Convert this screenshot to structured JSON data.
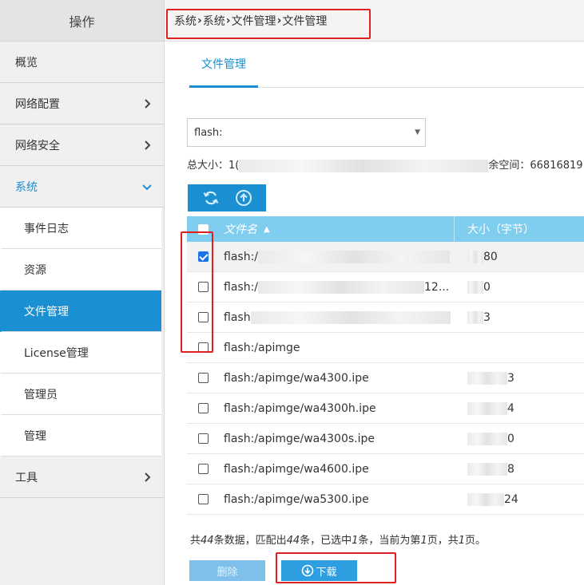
{
  "sidebar": {
    "header": "操作",
    "items": [
      {
        "label": "概览",
        "chevron": "none"
      },
      {
        "label": "网络配置",
        "chevron": "right"
      },
      {
        "label": "网络安全",
        "chevron": "right"
      }
    ],
    "system": {
      "label": "系统",
      "chevron": "down",
      "children": [
        {
          "label": "事件日志"
        },
        {
          "label": "资源"
        },
        {
          "label": "文件管理"
        },
        {
          "label": "License管理"
        },
        {
          "label": "管理员"
        },
        {
          "label": "管理"
        }
      ]
    },
    "tools": {
      "label": "工具"
    }
  },
  "breadcrumb": {
    "items": [
      "系统",
      "系统",
      "文件管理",
      "文件管理"
    ]
  },
  "tabs": [
    {
      "label": "文件管理"
    }
  ],
  "storage": {
    "selected": "flash:",
    "size_prefix": "总大小：",
    "size_visible": "1(",
    "free_label": "余空间：",
    "free_value": "66816819"
  },
  "table": {
    "headers": {
      "name": "文件名",
      "size": "大小（字节）",
      "sort": "▲"
    },
    "rows": [
      {
        "name": "flash:/",
        "size": "80",
        "checked": true,
        "selected": true
      },
      {
        "name": "flash:/",
        "name_tail": "12...",
        "size": "0",
        "checked": false,
        "selected": false
      },
      {
        "name": "flash",
        "size": "3",
        "checked": false,
        "selected": false
      },
      {
        "name": "flash:/apimge",
        "size": "",
        "checked": false,
        "selected": false
      },
      {
        "name": "flash:/apimge/wa4300.ipe",
        "size": "3",
        "checked": false,
        "selected": false
      },
      {
        "name": "flash:/apimge/wa4300h.ipe",
        "size": "4",
        "checked": false,
        "selected": false
      },
      {
        "name": "flash:/apimge/wa4300s.ipe",
        "size": "0",
        "checked": false,
        "selected": false
      },
      {
        "name": "flash:/apimge/wa4600.ipe",
        "size": "8",
        "checked": false,
        "selected": false
      },
      {
        "name": "flash:/apimge/wa5300.ipe",
        "size": "24",
        "checked": false,
        "selected": false
      }
    ]
  },
  "summary": {
    "p1": "共",
    "total": "44",
    "p2": "条数据，匹配出",
    "matched": "44",
    "p3": "条，已选中",
    "selected": "1",
    "p4": "条，当前为第",
    "page": "1",
    "p5": "页，共",
    "pages": "1",
    "p6": "页。"
  },
  "buttons": {
    "delete": "删除",
    "download": "下载"
  },
  "colors": {
    "accent": "#1a8fd1",
    "header_row": "#7fcdef",
    "highlight_box": "#e02020"
  }
}
